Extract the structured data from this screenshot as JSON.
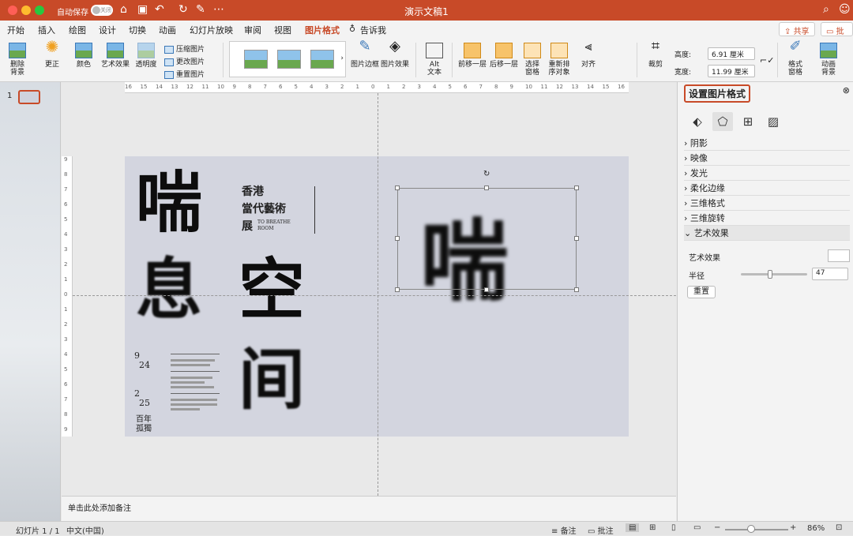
{
  "titlebar": {
    "autosave": "自动保存",
    "toggle": "关闭",
    "doc_title": "演示文稿1"
  },
  "tabs": [
    "开始",
    "插入",
    "绘图",
    "设计",
    "切换",
    "动画",
    "幻灯片放映",
    "审阅",
    "视图",
    "图片格式",
    "告诉我"
  ],
  "share": "共享",
  "comment": "批注",
  "ribbon": {
    "remove_bg": "删除\n背景",
    "correct": "更正",
    "color": "颜色",
    "art": "艺术效果",
    "transparency": "透明度",
    "compress": "压缩图片",
    "change": "更改图片",
    "reset": "重置图片",
    "border": "图片边框",
    "effects": "图片效果",
    "alt": "Alt\n文本",
    "forward": "前移一层",
    "backward": "后移一层",
    "select_pane": "选择\n窗格",
    "reorder": "重新排\n序对象",
    "align": "对齐",
    "crop": "裁剪",
    "height_label": "高度:",
    "height": "6.91 厘米",
    "width_label": "宽度:",
    "width": "11.99 厘米",
    "format_pane": "格式\n窗格",
    "anim_bg": "动画\n背景"
  },
  "ruler": {
    "h": [
      "16",
      "15",
      "14",
      "13",
      "12",
      "11",
      "10",
      "9",
      "8",
      "7",
      "6",
      "5",
      "4",
      "3",
      "2",
      "1",
      "0",
      "1",
      "2",
      "3",
      "4",
      "5",
      "6",
      "7",
      "8",
      "9",
      "10",
      "11",
      "12",
      "13",
      "14",
      "15",
      "16"
    ],
    "v": [
      "9",
      "8",
      "7",
      "6",
      "5",
      "4",
      "3",
      "2",
      "1",
      "0",
      "1",
      "2",
      "3",
      "4",
      "5",
      "6",
      "7",
      "8",
      "9"
    ]
  },
  "slides": {
    "number": "1"
  },
  "slide": {
    "c1": "喘",
    "c2": "息",
    "c3": "空",
    "c4": "间",
    "subtitle1": "香港",
    "subtitle2": "當代藝術",
    "subtitle3": "展",
    "en1": "TO BREATHE",
    "en2": "ROOM",
    "date1": "9",
    "date2": "24",
    "date3": "2",
    "date4": "25",
    "tag1": "百年",
    "tag2": "孤獨",
    "picture_char": "喘"
  },
  "notes": "单击此处添加备注",
  "panel": {
    "title": "设置图片格式",
    "sections": [
      "阴影",
      "映像",
      "发光",
      "柔化边缘",
      "三维格式",
      "三维旋转",
      "艺术效果"
    ],
    "art_label": "艺术效果",
    "radius_label": "半径",
    "radius_value": "47",
    "reset": "重置",
    "radius_fraction": 0.44
  },
  "status": {
    "slide": "幻灯片 1 / 1",
    "lang": "中文(中国)",
    "notes": "备注",
    "comments": "批注",
    "zoom": "86%"
  },
  "colors": {
    "accent": "#c84a28"
  }
}
